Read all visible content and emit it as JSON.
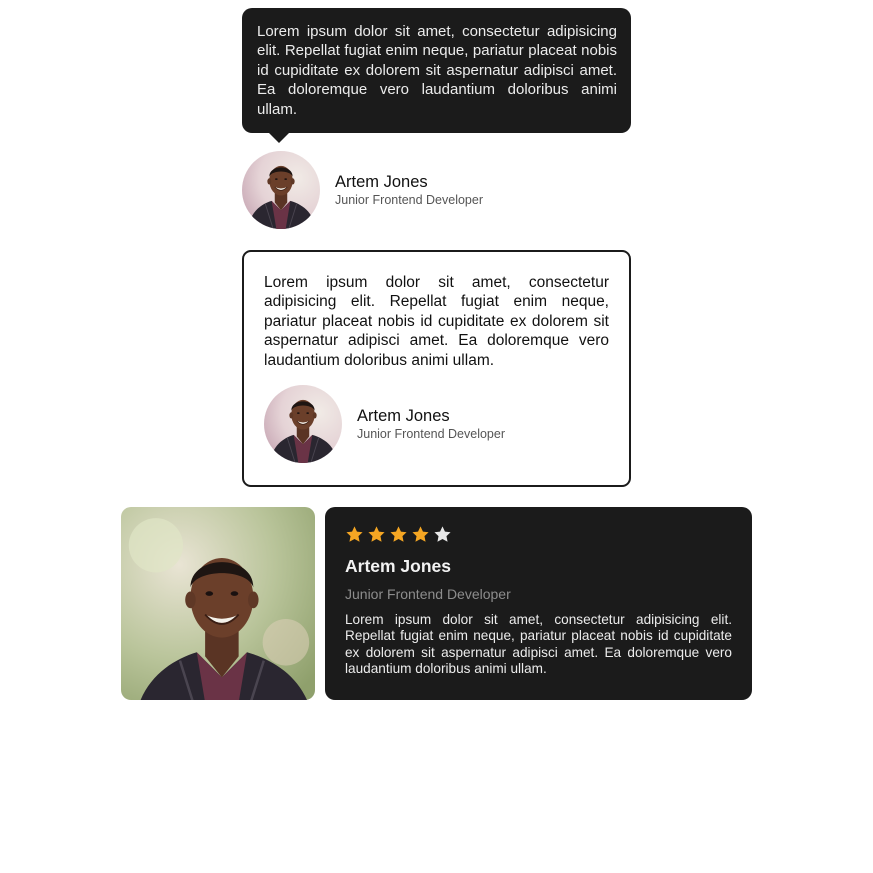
{
  "testimonial_bubble": {
    "quote": "Lorem ipsum dolor sit amet, consectetur adipisicing elit. Repellat fugiat enim neque, pariatur placeat nobis id cupiditate ex dolorem sit aspernatur adipisci amet. Ea doloremque vero laudantium doloribus animi ullam.",
    "author_name": "Artem Jones",
    "author_role": "Junior Frontend Developer"
  },
  "testimonial_outlined": {
    "quote": "Lorem ipsum dolor sit amet, consectetur adipisicing elit. Repellat fugiat enim neque, pariatur placeat nobis id cupiditate ex dolorem sit aspernatur adipisci amet. Ea doloremque vero laudantium doloribus animi ullam.",
    "author_name": "Artem Jones",
    "author_role": "Junior Frontend Developer"
  },
  "testimonial_photo": {
    "rating": 4,
    "rating_max": 5,
    "author_name": "Artem Jones",
    "author_role": "Junior Frontend Developer",
    "quote": "Lorem ipsum dolor sit amet, consectetur adipisicing elit. Repellat fugiat enim neque, pariatur placeat nobis id cupiditate ex dolorem sit aspernatur adipisci amet. Ea doloremque vero laudantium doloribus animi ullam."
  },
  "colors": {
    "card_dark": "#1b1b1b",
    "star_filled": "#f5a623",
    "star_empty": "#e8e8e8"
  },
  "icons": {
    "avatar": "portrait-photo",
    "star": "star-icon"
  }
}
